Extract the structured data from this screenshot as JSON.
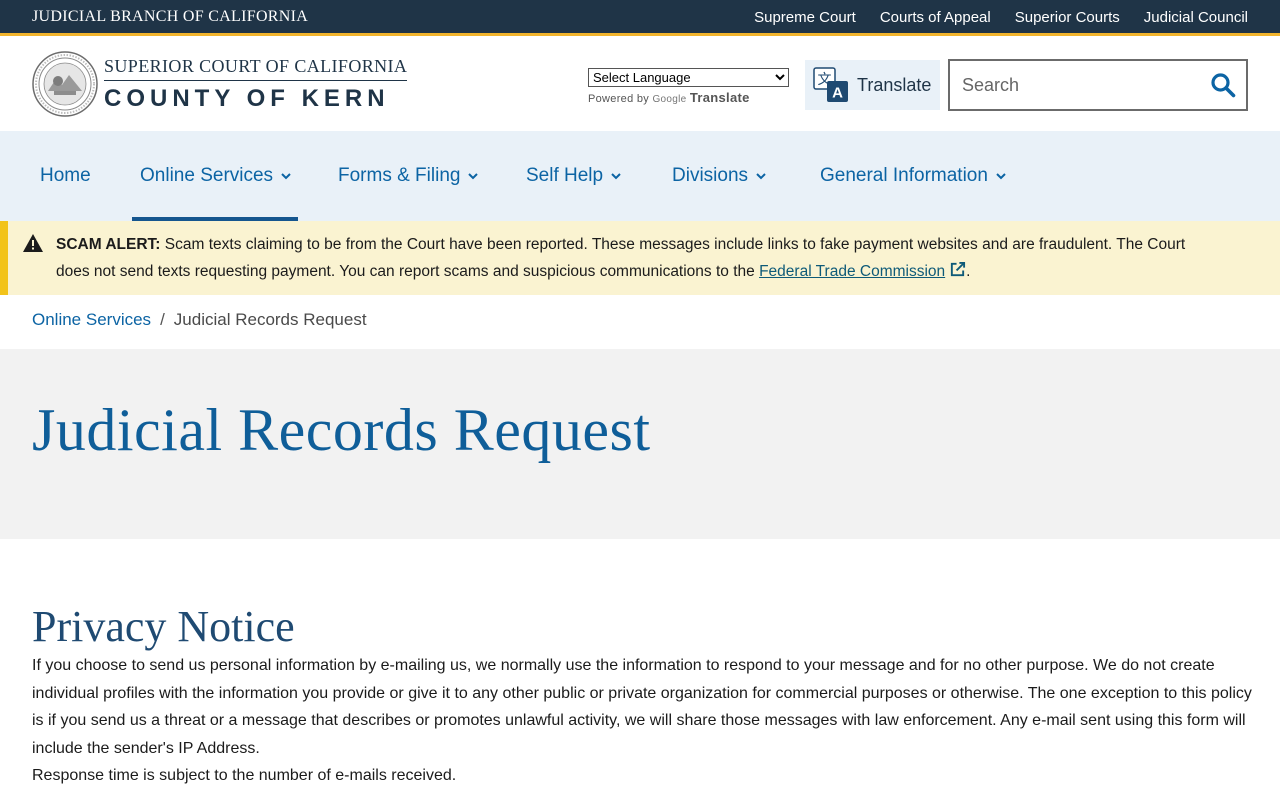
{
  "topbar": {
    "brand": "JUDICIAL BRANCH OF CALIFORNIA",
    "links": [
      "Supreme Court",
      "Courts of Appeal",
      "Superior Courts",
      "Judicial Council"
    ]
  },
  "header": {
    "logo_line1": "SUPERIOR COURT OF CALIFORNIA",
    "logo_line2": "COUNTY OF KERN",
    "language_select": "Select Language",
    "powered_by": "Powered by",
    "google_label": "Google",
    "translate_brand": "Translate",
    "translate_button": "Translate",
    "search_placeholder": "Search"
  },
  "nav": {
    "items": [
      "Home",
      "Online Services",
      "Forms & Filing",
      "Self Help",
      "Divisions",
      "General Information"
    ],
    "active": "Online Services"
  },
  "alert": {
    "label": "SCAM ALERT:",
    "text": " Scam texts claiming to be from the Court have been reported. These messages include links to fake payment websites and are fraudulent. The Court does not send texts requesting payment. You can report scams and suspicious communications to the ",
    "link_text": "Federal Trade Commission",
    "end": "."
  },
  "breadcrumb": {
    "parent": "Online Services",
    "separator": "/",
    "current": "Judicial Records Request"
  },
  "page_title": "Judicial Records Request",
  "content": {
    "heading": "Privacy Notice",
    "paragraph1": "If you choose to send us personal information by e-mailing us, we normally use the information to respond to your message and for no other purpose. We do not create individual profiles with the information you provide or give it to any other public or private organization for commercial purposes or otherwise. The one exception to this policy is if you send us a threat or a message that describes or promotes unlawful activity, we will share those messages with law enforcement. Any e-mail sent using this form will include the sender's IP Address.",
    "paragraph2": "Response time is subject to the number of e-mails received."
  },
  "colors": {
    "topbar_bg": "#1f3447",
    "accent_gold": "#f2b42c",
    "link_blue": "#0c64a4",
    "nav_bg": "#e9f1f8",
    "alert_bg": "#faf3d1",
    "title_blue": "#0f5e99"
  },
  "icons": {
    "seal": "court-seal-icon",
    "translate": "translate-icon",
    "search": "search-icon",
    "chevron": "chevron-down-icon",
    "warning": "warning-icon",
    "external": "external-link-icon"
  }
}
